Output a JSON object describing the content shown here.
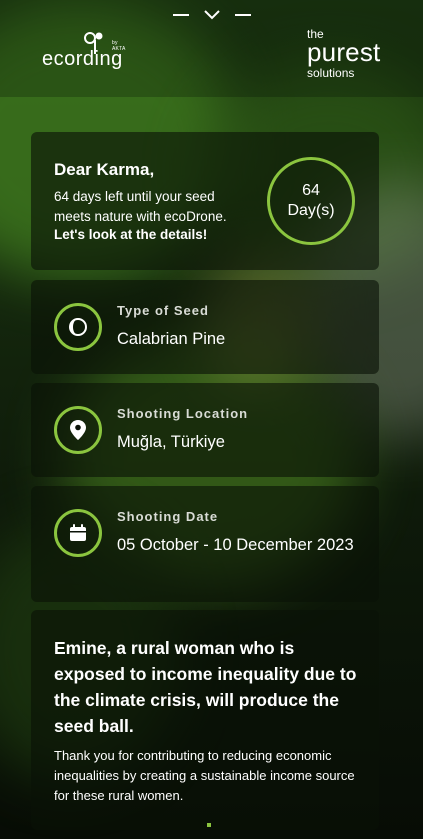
{
  "header": {
    "ecording_logo": "ecording",
    "ecording_tagline": "by AKTA",
    "purest_logo": {
      "the": "the",
      "purest": "purest",
      "solutions": "solutions"
    }
  },
  "greeting": {
    "title": "Dear Karma,",
    "message": "64 days left until your seed meets nature with ecoDrone.",
    "cta": "Let's look at the details!",
    "days_count": "64",
    "days_unit": "Day(s)"
  },
  "details": [
    {
      "label": "Type of Seed",
      "value": "Calabrian Pine",
      "icon": "seed-icon"
    },
    {
      "label": "Shooting Location",
      "value": "Muğla, Türkiye",
      "icon": "location-pin-icon"
    },
    {
      "label": "Shooting Date",
      "value": "05 October - 10 December 2023",
      "icon": "calendar-icon"
    }
  ],
  "story": {
    "headline": "Emine, a rural woman who is exposed to income inequality due to the climate crisis, will produce the seed ball.",
    "body": "Thank you for contributing to reducing economic inequalities by creating a sustainable income source for these rural women."
  },
  "colors": {
    "accent": "#8bc53f",
    "card_bg": "#0a1207"
  }
}
